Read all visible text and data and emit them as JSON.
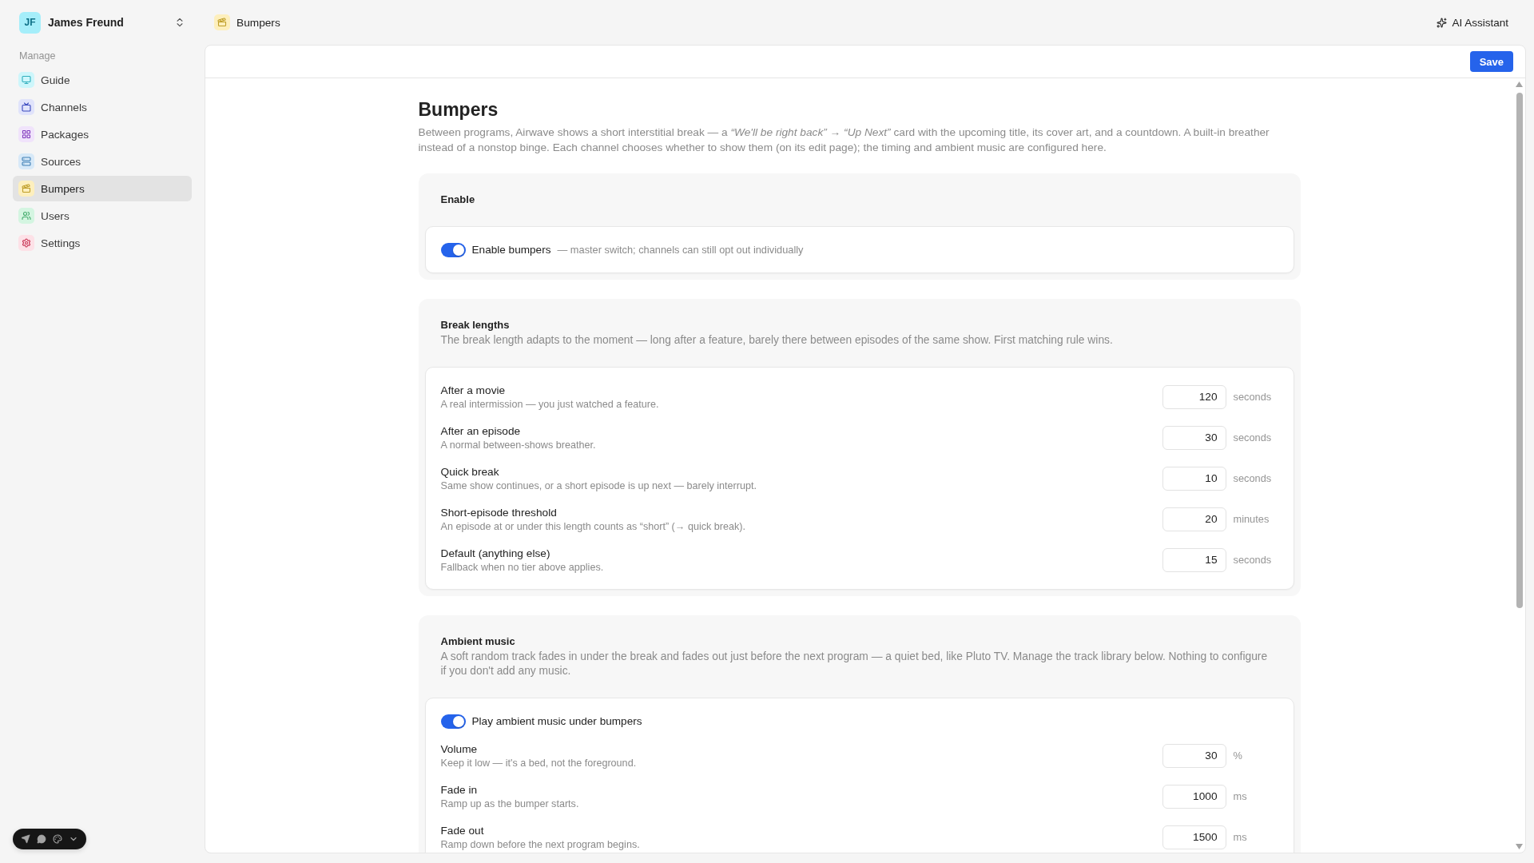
{
  "account": {
    "initials": "JF",
    "name": "James Freund"
  },
  "sidebar": {
    "section": "Manage",
    "items": [
      {
        "label": "Guide",
        "color": "#cdf6fb",
        "selected": false
      },
      {
        "label": "Channels",
        "color": "#e0e3fb",
        "selected": false
      },
      {
        "label": "Packages",
        "color": "#f0e3fb",
        "selected": false
      },
      {
        "label": "Sources",
        "color": "#d7e9f8",
        "selected": false
      },
      {
        "label": "Bumpers",
        "color": "#fdefbd",
        "selected": true
      },
      {
        "label": "Users",
        "color": "#d4f5e1",
        "selected": false
      },
      {
        "label": "Settings",
        "color": "#fde1e7",
        "selected": false
      }
    ]
  },
  "breadcrumb": {
    "label": "Bumpers"
  },
  "assistant": {
    "label": "AI Assistant"
  },
  "toolbar": {
    "save": "Save"
  },
  "page": {
    "title": "Bumpers",
    "description": "Between programs, Airwave shows a short interstitial break — a *“We'll be right back”* → *“Up Next”* card with the upcoming title, its cover art, and a countdown. A built-in breather instead of a nonstop binge. Each channel chooses whether to show them (on its edit page); the timing and ambient music are configured here."
  },
  "sections": [
    {
      "title": "Enable",
      "items": [
        {
          "kind": "toggle",
          "label": "Enable bumpers",
          "hint": "— master switch; channels can still opt out individually",
          "on": true
        }
      ]
    },
    {
      "title": "Break lengths",
      "description": "The break length adapts to the moment — long after a feature, barely there between episodes of the same show. First matching rule wins.",
      "items": [
        {
          "kind": "number",
          "label": "After a movie",
          "description": "A real intermission — you just watched a feature.",
          "value": "120",
          "unit": "seconds"
        },
        {
          "kind": "number",
          "label": "After an episode",
          "description": "A normal between-shows breather.",
          "value": "30",
          "unit": "seconds"
        },
        {
          "kind": "number",
          "label": "Quick break",
          "description": "Same show continues, or a short episode is up next — barely interrupt.",
          "value": "10",
          "unit": "seconds"
        },
        {
          "kind": "number",
          "label": "Short-episode threshold",
          "description": "An episode at or under this length counts as “short” (→ quick break).",
          "value": "20",
          "unit": "minutes"
        },
        {
          "kind": "number",
          "label": "Default (anything else)",
          "description": "Fallback when no tier above applies.",
          "value": "15",
          "unit": "seconds"
        }
      ]
    },
    {
      "title": "Ambient music",
      "description": "A soft random track fades in under the break and fades out just before the next program — a quiet bed, like Pluto TV. Manage the track library below. Nothing to configure if you don't add any music.",
      "items": [
        {
          "kind": "toggle",
          "label": "Play ambient music under bumpers",
          "on": true
        },
        {
          "kind": "number",
          "label": "Volume",
          "description": "Keep it low — it's a bed, not the foreground.",
          "value": "30",
          "unit": "%"
        },
        {
          "kind": "number",
          "label": "Fade in",
          "description": "Ramp up as the bumper starts.",
          "value": "1000",
          "unit": "ms"
        },
        {
          "kind": "number",
          "label": "Fade out",
          "description": "Ramp down before the next program begins.",
          "value": "1500",
          "unit": "ms"
        }
      ]
    }
  ]
}
